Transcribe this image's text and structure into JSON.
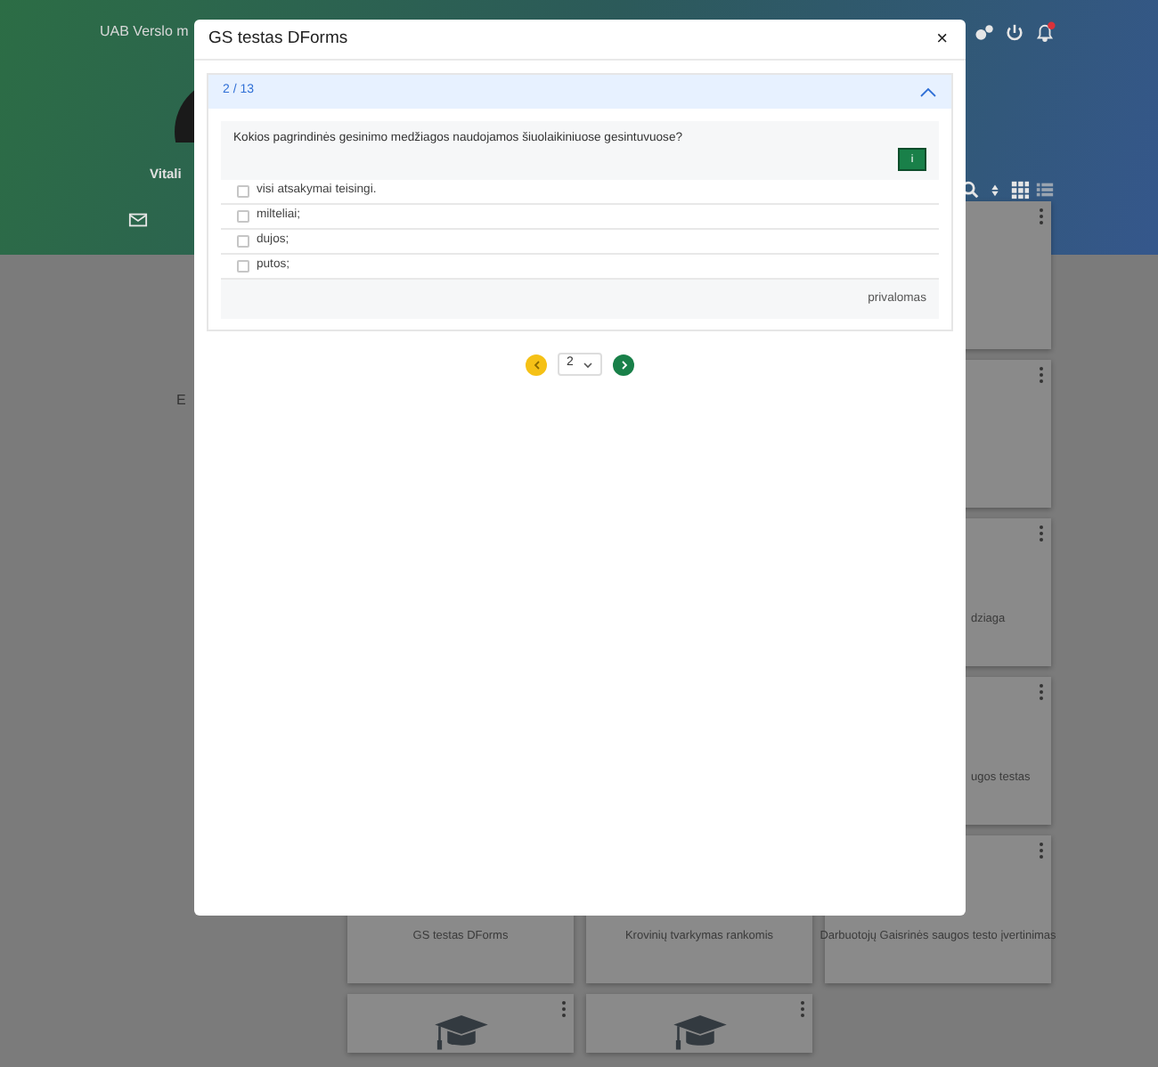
{
  "background": {
    "company": "UAB Verslo m",
    "user_name": "Vitali",
    "side_text": "E",
    "column_cards": [
      {
        "kind": "blank"
      },
      {
        "kind": "blank"
      },
      {
        "kind": "text",
        "title": "dziaga"
      },
      {
        "kind": "text",
        "title": "ugos testas"
      }
    ],
    "row_cards": [
      {
        "kind": "text",
        "title": "GS testas DForms"
      },
      {
        "kind": "text",
        "title": "Krovinių tvarkymas rankomis"
      },
      {
        "kind": "text",
        "title": "Darbuotojų Gaisrinės saugos testo įvertinimas"
      },
      {
        "kind": "cap"
      },
      {
        "kind": "cap"
      }
    ]
  },
  "modal": {
    "title": "GS testas DForms",
    "close": "×",
    "section": {
      "counter": "2 / 13",
      "expanded": true,
      "question": "Kokios pagrindinės gesinimo medžiagos naudojamos šiuolaikiniuose gesintuvuose?",
      "info_button": "i",
      "options": [
        {
          "label": "visi atsakymai teisingi.",
          "checked": false
        },
        {
          "label": "milteliai;",
          "checked": false
        },
        {
          "label": "dujos;",
          "checked": false
        },
        {
          "label": "putos;",
          "checked": false
        }
      ],
      "footer": "privalomas"
    },
    "pager": {
      "page": "2"
    }
  }
}
